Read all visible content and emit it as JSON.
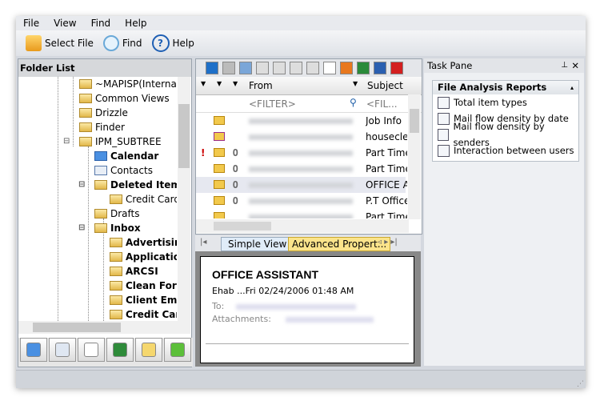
{
  "menu": [
    "File",
    "View",
    "Find",
    "Help"
  ],
  "toolbar": {
    "select_file": "Select File",
    "find": "Find",
    "help": "Help"
  },
  "folder_list": {
    "title": "Folder List",
    "items": [
      {
        "label": "~MAPISP(Internal)",
        "bold": false
      },
      {
        "label": "Common Views",
        "bold": false
      },
      {
        "label": "Drizzle",
        "bold": false
      },
      {
        "label": "Finder",
        "bold": false
      },
      {
        "label": "IPM_SUBTREE",
        "bold": false
      },
      {
        "label": "Calendar",
        "bold": true
      },
      {
        "label": "Contacts",
        "bold": false
      },
      {
        "label": "Deleted Items",
        "bold": true
      },
      {
        "label": "Credit Card",
        "bold": false
      },
      {
        "label": "Drafts",
        "bold": false
      },
      {
        "label": "Inbox",
        "bold": true
      },
      {
        "label": "Advertising",
        "bold": true
      },
      {
        "label": "Applications",
        "bold": true
      },
      {
        "label": "ARCSI",
        "bold": true
      },
      {
        "label": "Clean For A",
        "bold": true
      },
      {
        "label": "Client Email",
        "bold": true
      },
      {
        "label": "Credit Card",
        "bold": true
      }
    ]
  },
  "bottom_buttons": [
    "calendar-icon",
    "contacts-icon",
    "tasks-icon",
    "journal-icon",
    "notes-icon",
    "up-arrow-icon"
  ],
  "message_list": {
    "toolbar_icons": [
      "ie-icon",
      "hand-icon",
      "check-calendar-icon",
      "day-1-icon",
      "day-5-icon",
      "day-7-icon",
      "day-31-icon",
      "mail-icon",
      "eml-icon",
      "txt-icon",
      "rtf-icon",
      "pdf-icon"
    ],
    "columns": {
      "from": "From",
      "subject": "Subject"
    },
    "filter": {
      "from": "<FILTER>",
      "subject": "<FIL..."
    },
    "rows": [
      {
        "subject": "Job Info",
        "important": false,
        "attachment": false,
        "icon": "envelope"
      },
      {
        "subject": "houseclean",
        "important": false,
        "attachment": false,
        "icon": "replied"
      },
      {
        "subject": "Part Time C",
        "important": true,
        "attachment": true,
        "icon": "envelope"
      },
      {
        "subject": "Part Time C",
        "important": false,
        "attachment": true,
        "icon": "envelope"
      },
      {
        "subject": "OFFICE ASS",
        "important": false,
        "attachment": true,
        "icon": "envelope",
        "selected": true
      },
      {
        "subject": "P.T Office",
        "important": false,
        "attachment": true,
        "icon": "envelope"
      },
      {
        "subject": "Part Time C",
        "important": false,
        "attachment": false,
        "icon": "envelope"
      }
    ]
  },
  "preview": {
    "tabs": [
      "Simple View",
      "Advanced Propert..."
    ],
    "active_tab": 1,
    "subject": "OFFICE ASSISTANT",
    "from_date": "Ehab ...Fri 02/24/2006 01:48 AM",
    "to_label": "To:",
    "attachments_label": "Attachments:"
  },
  "task_pane": {
    "title": "Task Pane",
    "section": "File Analysis Reports",
    "items": [
      "Total item types",
      "Mail flow density by date",
      "Mail flow density by senders",
      "Interaction between users"
    ]
  }
}
